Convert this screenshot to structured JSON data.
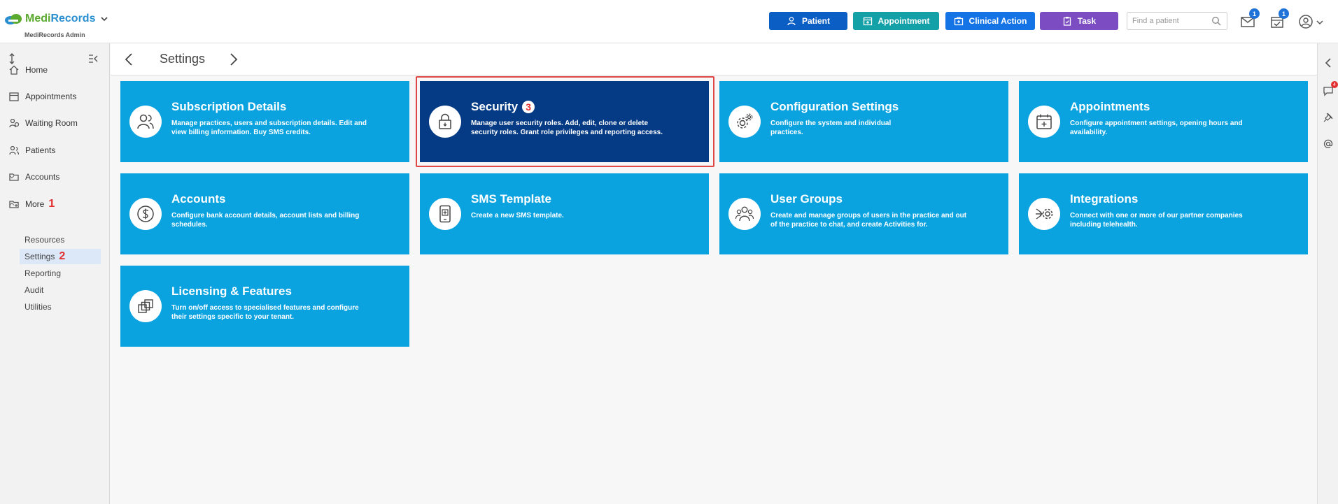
{
  "app": {
    "brand_part1": "Medi",
    "brand_part2": "Records",
    "subtitle": "MediRecords Admin"
  },
  "header": {
    "buttons": [
      {
        "label": "Patient",
        "icon": "person-icon",
        "color": "#0b5fc4"
      },
      {
        "label": "Appointment",
        "icon": "calendar-icon",
        "color": "#13a0a7"
      },
      {
        "label": "Clinical Action",
        "icon": "medical-kit-icon",
        "color": "#1474e6"
      },
      {
        "label": "Task",
        "icon": "clipboard-icon",
        "color": "#7c4cc2"
      }
    ],
    "search_placeholder": "Find a patient",
    "mail_count": "1",
    "tasks_count": "1"
  },
  "sidebar": {
    "items": [
      {
        "label": "Home",
        "icon": "home-icon"
      },
      {
        "label": "Appointments",
        "icon": "calendar-icon"
      },
      {
        "label": "Waiting Room",
        "icon": "waiting-room-icon"
      },
      {
        "label": "Patients",
        "icon": "patients-icon"
      },
      {
        "label": "Accounts",
        "icon": "folder-icon"
      },
      {
        "label": "More",
        "icon": "folder-plus-icon"
      }
    ],
    "more_step": "1",
    "sub_items": [
      "Resources",
      "Settings",
      "Reporting",
      "Audit",
      "Utilities"
    ],
    "settings_step": "2"
  },
  "page": {
    "title": "Settings"
  },
  "tiles": [
    {
      "title": "Subscription Details",
      "desc": "Manage practices, users and subscription details. Edit and view billing information. Buy SMS credits.",
      "icon": "users-icon"
    },
    {
      "title": "Security",
      "desc": "Manage user security roles. Add, edit, clone or delete security roles. Grant role privileges and reporting access.",
      "icon": "lock-icon",
      "step": "3"
    },
    {
      "title": "Configuration Settings",
      "desc": "Configure the system and individual practices.",
      "icon": "gears-icon"
    },
    {
      "title": "Appointments",
      "desc": "Configure appointment settings, opening hours and availability.",
      "icon": "calendar-plus-icon"
    },
    {
      "title": "Accounts",
      "desc": "Configure bank account details, account lists and billing schedules.",
      "icon": "dollar-icon"
    },
    {
      "title": "SMS Template",
      "desc": "Create a new SMS template.",
      "icon": "phone-icon"
    },
    {
      "title": "User Groups",
      "desc": "Create and manage groups of users in the practice and out of the practice to chat, and create Activities for.",
      "icon": "user-group-icon"
    },
    {
      "title": "Integrations",
      "desc": "Connect with one or more of our partner companies including telehealth.",
      "icon": "integration-icon"
    },
    {
      "title": "Licensing & Features",
      "desc": "Turn on/off access to specialised features and configure their settings specific to your tenant.",
      "icon": "layers-icon"
    }
  ],
  "rail": {
    "chat_count": "4"
  }
}
